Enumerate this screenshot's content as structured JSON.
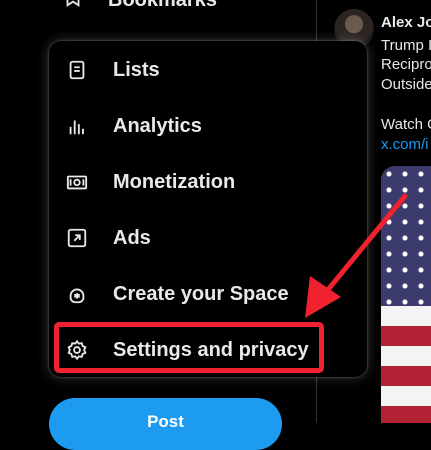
{
  "sidebar": {
    "bookmarks": {
      "label": "Bookmarks",
      "icon": "bookmark-icon"
    },
    "post_button": {
      "label": "Post"
    }
  },
  "menu": {
    "items": [
      {
        "label": "Lists",
        "icon": "list-icon"
      },
      {
        "label": "Analytics",
        "icon": "analytics-icon"
      },
      {
        "label": "Monetization",
        "icon": "monetization-icon"
      },
      {
        "label": "Ads",
        "icon": "ads-icon"
      },
      {
        "label": "Create your Space",
        "icon": "space-icon"
      },
      {
        "label": "Settings and privacy",
        "icon": "gear-icon"
      }
    ],
    "highlighted": "Settings and privacy"
  },
  "annotation": {
    "color": "#f0222f"
  },
  "timeline": {
    "tweet": {
      "author": "Alex Jo",
      "lines": [
        "Trump I",
        "Recipro",
        "Outside"
      ],
      "watch_text": "Watch C",
      "link_text": "x.com/i"
    }
  },
  "colors": {
    "accent": "#1d9bf0",
    "text": "#e7e9ea",
    "background": "#000000"
  }
}
